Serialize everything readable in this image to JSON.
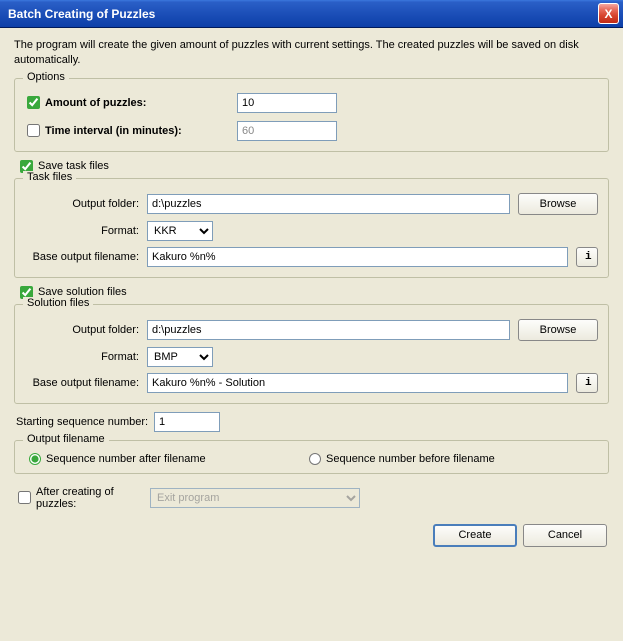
{
  "window": {
    "title": "Batch Creating of Puzzles",
    "close_x": "X"
  },
  "intro": "The program will create the given amount of puzzles with current settings. The created puzzles will be saved on disk automatically.",
  "options": {
    "title": "Options",
    "amount_label": "Amount of puzzles:",
    "amount_value": "10",
    "amount_checked": true,
    "interval_label": "Time interval (in minutes):",
    "interval_value": "60",
    "interval_checked": false
  },
  "save_task": {
    "checkbox": "Save task files",
    "checked": true,
    "group_title": "Task files",
    "output_folder_label": "Output folder:",
    "output_folder_value": "d:\\puzzles",
    "browse": "Browse",
    "format_label": "Format:",
    "format_value": "KKR",
    "base_label": "Base output filename:",
    "base_value": "Kakuro %n%",
    "info": "i"
  },
  "save_solution": {
    "checkbox": "Save solution files",
    "checked": true,
    "group_title": "Solution files",
    "output_folder_label": "Output folder:",
    "output_folder_value": "d:\\puzzles",
    "browse": "Browse",
    "format_label": "Format:",
    "format_value": "BMP",
    "base_label": "Base output filename:",
    "base_value": "Kakuro %n% - Solution",
    "info": "i"
  },
  "sequence": {
    "label": "Starting sequence number:",
    "value": "1"
  },
  "output_filename": {
    "title": "Output filename",
    "after": "Sequence number after filename",
    "before": "Sequence number before filename",
    "selected": "after"
  },
  "after_creating": {
    "label": "After creating of puzzles:",
    "checked": false,
    "value": "Exit program"
  },
  "buttons": {
    "create": "Create",
    "cancel": "Cancel"
  }
}
